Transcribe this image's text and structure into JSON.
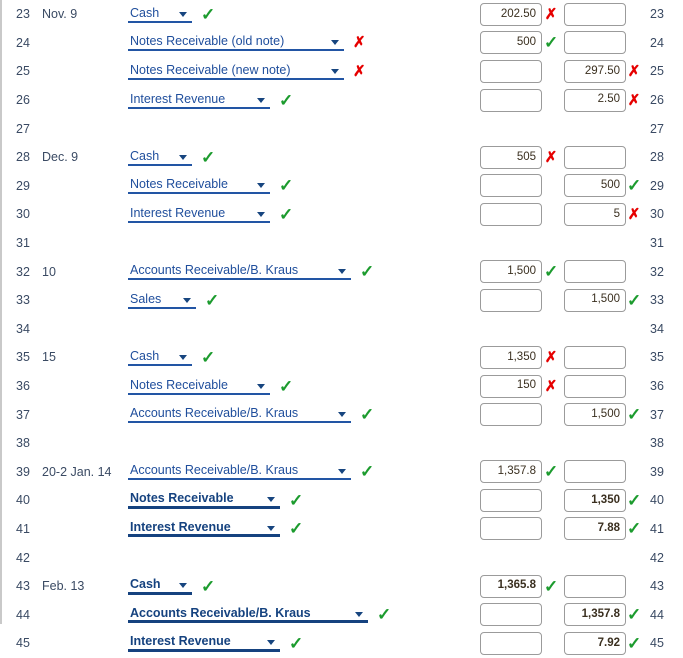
{
  "meta": {
    "title": "General Journal Entry Grid",
    "colors": {
      "correct": "#1c9b2e",
      "incorrect": "#e60000",
      "account_link": "#1f4e9c",
      "line_number": "#3a4a63",
      "amount_text": "#3a2f1f",
      "input_border": "#9b9b9b"
    },
    "icons": {
      "correct": "✓",
      "incorrect": "✗",
      "dropdown": "chevron-down-icon"
    }
  },
  "rows": [
    {
      "line": "23",
      "date": "Nov. 9",
      "account": "Cash",
      "bold": false,
      "account_mark": "correct",
      "debit": "202.50",
      "debit_mark": "incorrect",
      "credit": "",
      "credit_mark": ""
    },
    {
      "line": "24",
      "date": "",
      "account": "Notes Receivable (old note)",
      "bold": false,
      "account_mark": "incorrect",
      "debit": "500",
      "debit_mark": "correct",
      "credit": "",
      "credit_mark": ""
    },
    {
      "line": "25",
      "date": "",
      "account": "Notes Receivable (new note)",
      "bold": false,
      "account_mark": "incorrect",
      "debit": "",
      "debit_mark": "",
      "credit": "297.50",
      "credit_mark": "incorrect"
    },
    {
      "line": "26",
      "date": "",
      "account": "Interest Revenue",
      "bold": false,
      "account_mark": "correct",
      "debit": "",
      "debit_mark": "",
      "credit": "2.50",
      "credit_mark": "incorrect"
    },
    {
      "line": "27",
      "date": "",
      "account": "",
      "bold": false,
      "account_mark": "",
      "debit": "",
      "debit_mark": "",
      "credit": "",
      "credit_mark": ""
    },
    {
      "line": "28",
      "date": "Dec. 9",
      "account": "Cash",
      "bold": false,
      "account_mark": "correct",
      "debit": "505",
      "debit_mark": "incorrect",
      "credit": "",
      "credit_mark": ""
    },
    {
      "line": "29",
      "date": "",
      "account": "Notes Receivable",
      "bold": false,
      "account_mark": "correct",
      "debit": "",
      "debit_mark": "",
      "credit": "500",
      "credit_mark": "correct"
    },
    {
      "line": "30",
      "date": "",
      "account": "Interest Revenue",
      "bold": false,
      "account_mark": "correct",
      "debit": "",
      "debit_mark": "",
      "credit": "5",
      "credit_mark": "incorrect"
    },
    {
      "line": "31",
      "date": "",
      "account": "",
      "bold": false,
      "account_mark": "",
      "debit": "",
      "debit_mark": "",
      "credit": "",
      "credit_mark": ""
    },
    {
      "line": "32",
      "date": "10",
      "account": "Accounts Receivable/B. Kraus",
      "bold": false,
      "account_mark": "correct",
      "debit": "1,500",
      "debit_mark": "correct",
      "credit": "",
      "credit_mark": ""
    },
    {
      "line": "33",
      "date": "",
      "account": "Sales",
      "bold": false,
      "account_mark": "correct",
      "debit": "",
      "debit_mark": "",
      "credit": "1,500",
      "credit_mark": "correct"
    },
    {
      "line": "34",
      "date": "",
      "account": "",
      "bold": false,
      "account_mark": "",
      "debit": "",
      "debit_mark": "",
      "credit": "",
      "credit_mark": ""
    },
    {
      "line": "35",
      "date": "15",
      "account": "Cash",
      "bold": false,
      "account_mark": "correct",
      "debit": "1,350",
      "debit_mark": "incorrect",
      "credit": "",
      "credit_mark": ""
    },
    {
      "line": "36",
      "date": "",
      "account": "Notes Receivable",
      "bold": false,
      "account_mark": "correct",
      "debit": "150",
      "debit_mark": "incorrect",
      "credit": "",
      "credit_mark": ""
    },
    {
      "line": "37",
      "date": "",
      "account": "Accounts Receivable/B. Kraus",
      "bold": false,
      "account_mark": "correct",
      "debit": "",
      "debit_mark": "",
      "credit": "1,500",
      "credit_mark": "correct"
    },
    {
      "line": "38",
      "date": "",
      "account": "",
      "bold": false,
      "account_mark": "",
      "debit": "",
      "debit_mark": "",
      "credit": "",
      "credit_mark": ""
    },
    {
      "line": "39",
      "date": "20-2 Jan. 14",
      "account": "Accounts Receivable/B. Kraus",
      "bold": false,
      "account_mark": "correct",
      "debit": "1,357.8",
      "debit_mark": "correct",
      "credit": "",
      "credit_mark": ""
    },
    {
      "line": "40",
      "date": "",
      "account": "Notes Receivable",
      "bold": true,
      "account_mark": "correct",
      "debit": "",
      "debit_mark": "",
      "credit": "1,350",
      "credit_mark": "correct"
    },
    {
      "line": "41",
      "date": "",
      "account": "Interest Revenue",
      "bold": true,
      "account_mark": "correct",
      "debit": "",
      "debit_mark": "",
      "credit": "7.88",
      "credit_mark": "correct"
    },
    {
      "line": "42",
      "date": "",
      "account": "",
      "bold": false,
      "account_mark": "",
      "debit": "",
      "debit_mark": "",
      "credit": "",
      "credit_mark": ""
    },
    {
      "line": "43",
      "date": "Feb. 13",
      "account": "Cash",
      "bold": true,
      "account_mark": "correct",
      "debit": "1,365.8",
      "debit_mark": "correct",
      "credit": "",
      "credit_mark": ""
    },
    {
      "line": "44",
      "date": "",
      "account": "Accounts Receivable/B. Kraus",
      "bold": true,
      "account_mark": "correct",
      "debit": "",
      "debit_mark": "",
      "credit": "1,357.8",
      "credit_mark": "correct"
    },
    {
      "line": "45",
      "date": "",
      "account": "Interest Revenue",
      "bold": true,
      "account_mark": "correct",
      "debit": "",
      "debit_mark": "",
      "credit": "7.92",
      "credit_mark": "correct"
    }
  ]
}
